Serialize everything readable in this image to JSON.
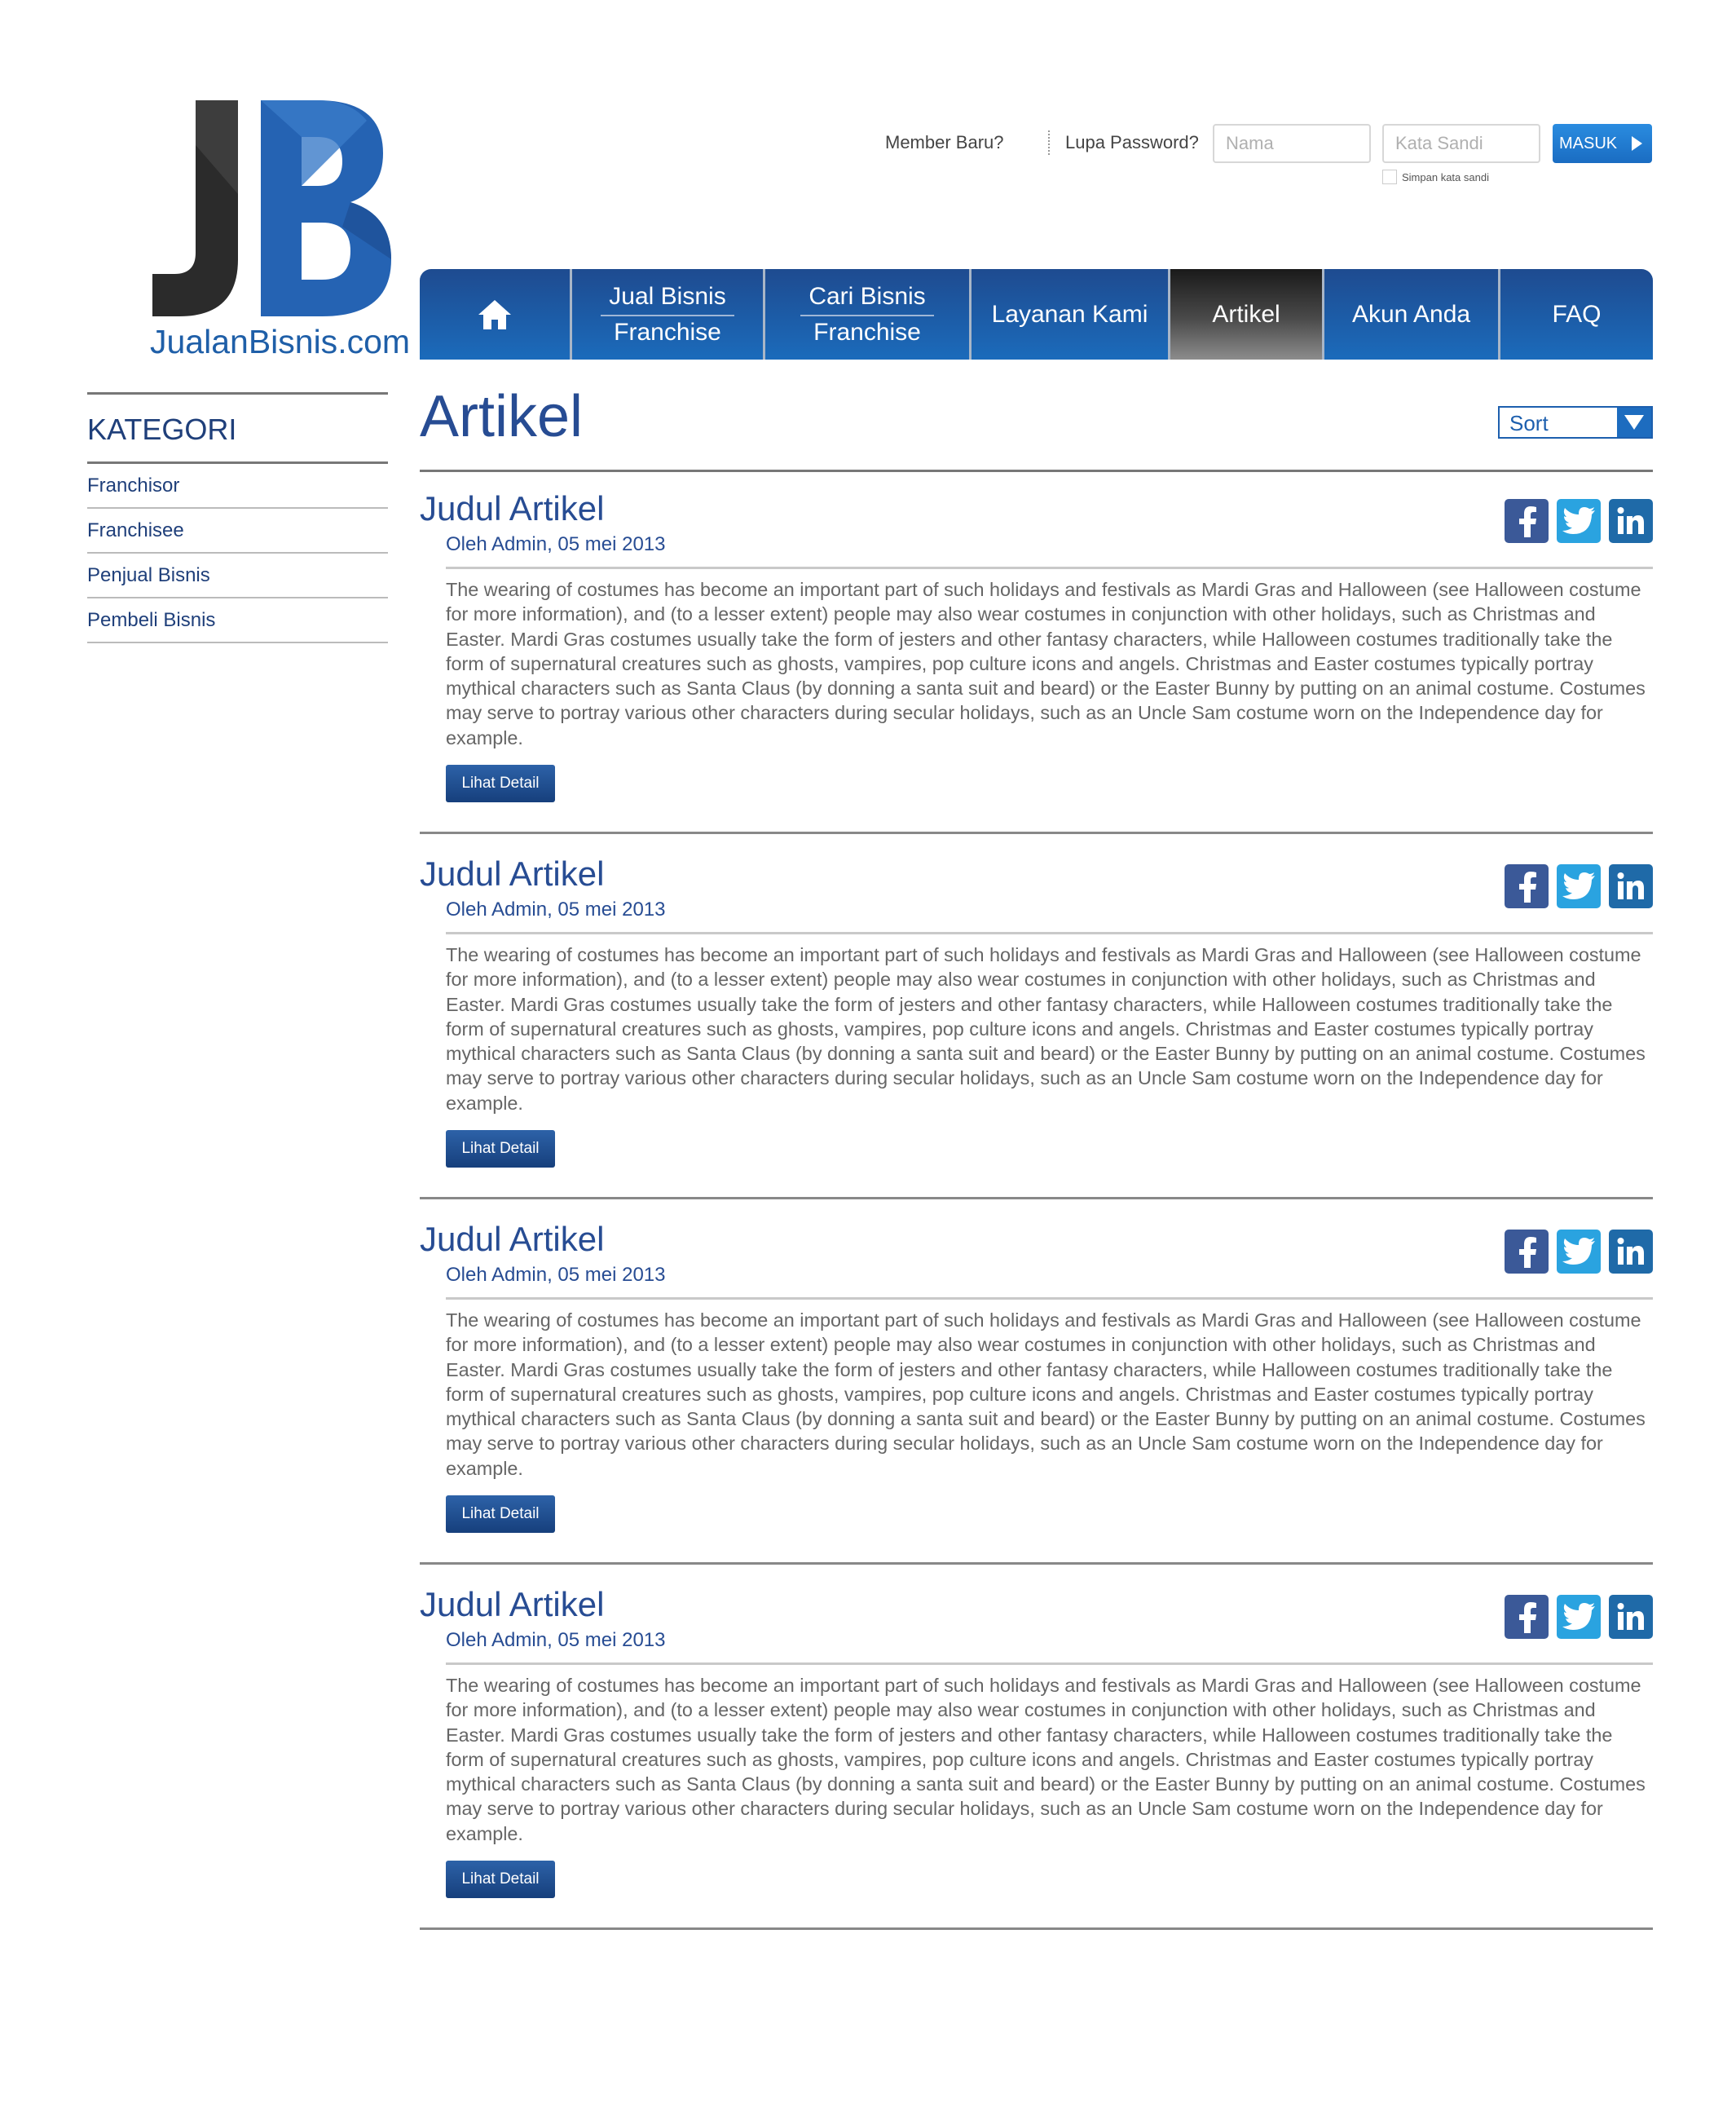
{
  "brand": {
    "logo_name": "JualanBisnis",
    "logo_suffix": ".com",
    "colors": {
      "primary": "#1f5fa8",
      "dark": "#274c93",
      "accent": "#1a6cc2"
    }
  },
  "login": {
    "member_link": "Member Baru?",
    "forgot_link": "Lupa Password?",
    "name_placeholder": "Nama",
    "password_placeholder": "Kata Sandi",
    "submit_label": "MASUK",
    "remember_label": "Simpan kata sandi"
  },
  "nav": {
    "home_icon": "home-icon",
    "items": [
      {
        "line1": "Jual Bisnis",
        "line2": "Franchise"
      },
      {
        "line1": "Cari Bisnis",
        "line2": "Franchise"
      },
      {
        "label": "Layanan Kami"
      },
      {
        "label": "Artikel",
        "active": true
      },
      {
        "label": "Akun Anda"
      },
      {
        "label": "FAQ"
      }
    ]
  },
  "sidebar": {
    "title": "KATEGORI",
    "items": [
      "Franchisor",
      "Franchisee",
      "Penjual Bisnis",
      "Pembeli Bisnis"
    ]
  },
  "main": {
    "title": "Artikel",
    "sort_label": "Sort",
    "articles": [
      {
        "title": "Judul Artikel",
        "meta": "Oleh Admin, 05 mei 2013",
        "body": "The wearing of costumes has become an important part of such holidays and festivals as Mardi Gras and Halloween (see Halloween costume for more information), and (to a lesser extent) people may also wear costumes in conjunction with other holidays, such as Christmas and Easter. Mardi Gras costumes usually take the form of jesters and other fantasy characters, while Halloween costumes traditionally take the form of supernatural creatures such as ghosts, vampires, pop culture icons and angels. Christmas and Easter costumes typically portray mythical characters such as Santa Claus (by donning a santa suit and beard) or the Easter Bunny by putting on an animal costume. Costumes may serve to portray various other characters during secular holidays, such as an Uncle Sam costume worn on the Independence day for example.",
        "button": "Lihat Detail"
      },
      {
        "title": "Judul Artikel",
        "meta": "Oleh Admin, 05 mei 2013",
        "body": "The wearing of costumes has become an important part of such holidays and festivals as Mardi Gras and Halloween (see Halloween costume for more information), and (to a lesser extent) people may also wear costumes in conjunction with other holidays, such as Christmas and Easter. Mardi Gras costumes usually take the form of jesters and other fantasy characters, while Halloween costumes traditionally take the form of supernatural creatures such as ghosts, vampires, pop culture icons and angels. Christmas and Easter costumes typically portray mythical characters such as Santa Claus (by donning a santa suit and beard) or the Easter Bunny by putting on an animal costume. Costumes may serve to portray various other characters during secular holidays, such as an Uncle Sam costume worn on the Independence day for example.",
        "button": "Lihat Detail"
      },
      {
        "title": "Judul Artikel",
        "meta": "Oleh Admin, 05 mei 2013",
        "body": "The wearing of costumes has become an important part of such holidays and festivals as Mardi Gras and Halloween (see Halloween costume for more information), and (to a lesser extent) people may also wear costumes in conjunction with other holidays, such as Christmas and Easter. Mardi Gras costumes usually take the form of jesters and other fantasy characters, while Halloween costumes traditionally take the form of supernatural creatures such as ghosts, vampires, pop culture icons and angels. Christmas and Easter costumes typically portray mythical characters such as Santa Claus (by donning a santa suit and beard) or the Easter Bunny by putting on an animal costume. Costumes may serve to portray various other characters during secular holidays, such as an Uncle Sam costume worn on the Independence day for example.",
        "button": "Lihat Detail"
      },
      {
        "title": "Judul Artikel",
        "meta": "Oleh Admin, 05 mei 2013",
        "body": "The wearing of costumes has become an important part of such holidays and festivals as Mardi Gras and Halloween (see Halloween costume for more information), and (to a lesser extent) people may also wear costumes in conjunction with other holidays, such as Christmas and Easter. Mardi Gras costumes usually take the form of jesters and other fantasy characters, while Halloween costumes traditionally take the form of supernatural creatures such as ghosts, vampires, pop culture icons and angels. Christmas and Easter costumes typically portray mythical characters such as Santa Claus (by donning a santa suit and beard) or the Easter Bunny by putting on an animal costume. Costumes may serve to portray various other characters during secular holidays, such as an Uncle Sam costume worn on the Independence day for example.",
        "button": "Lihat Detail"
      }
    ],
    "social_icons": [
      "facebook-icon",
      "twitter-icon",
      "linkedin-icon"
    ]
  }
}
